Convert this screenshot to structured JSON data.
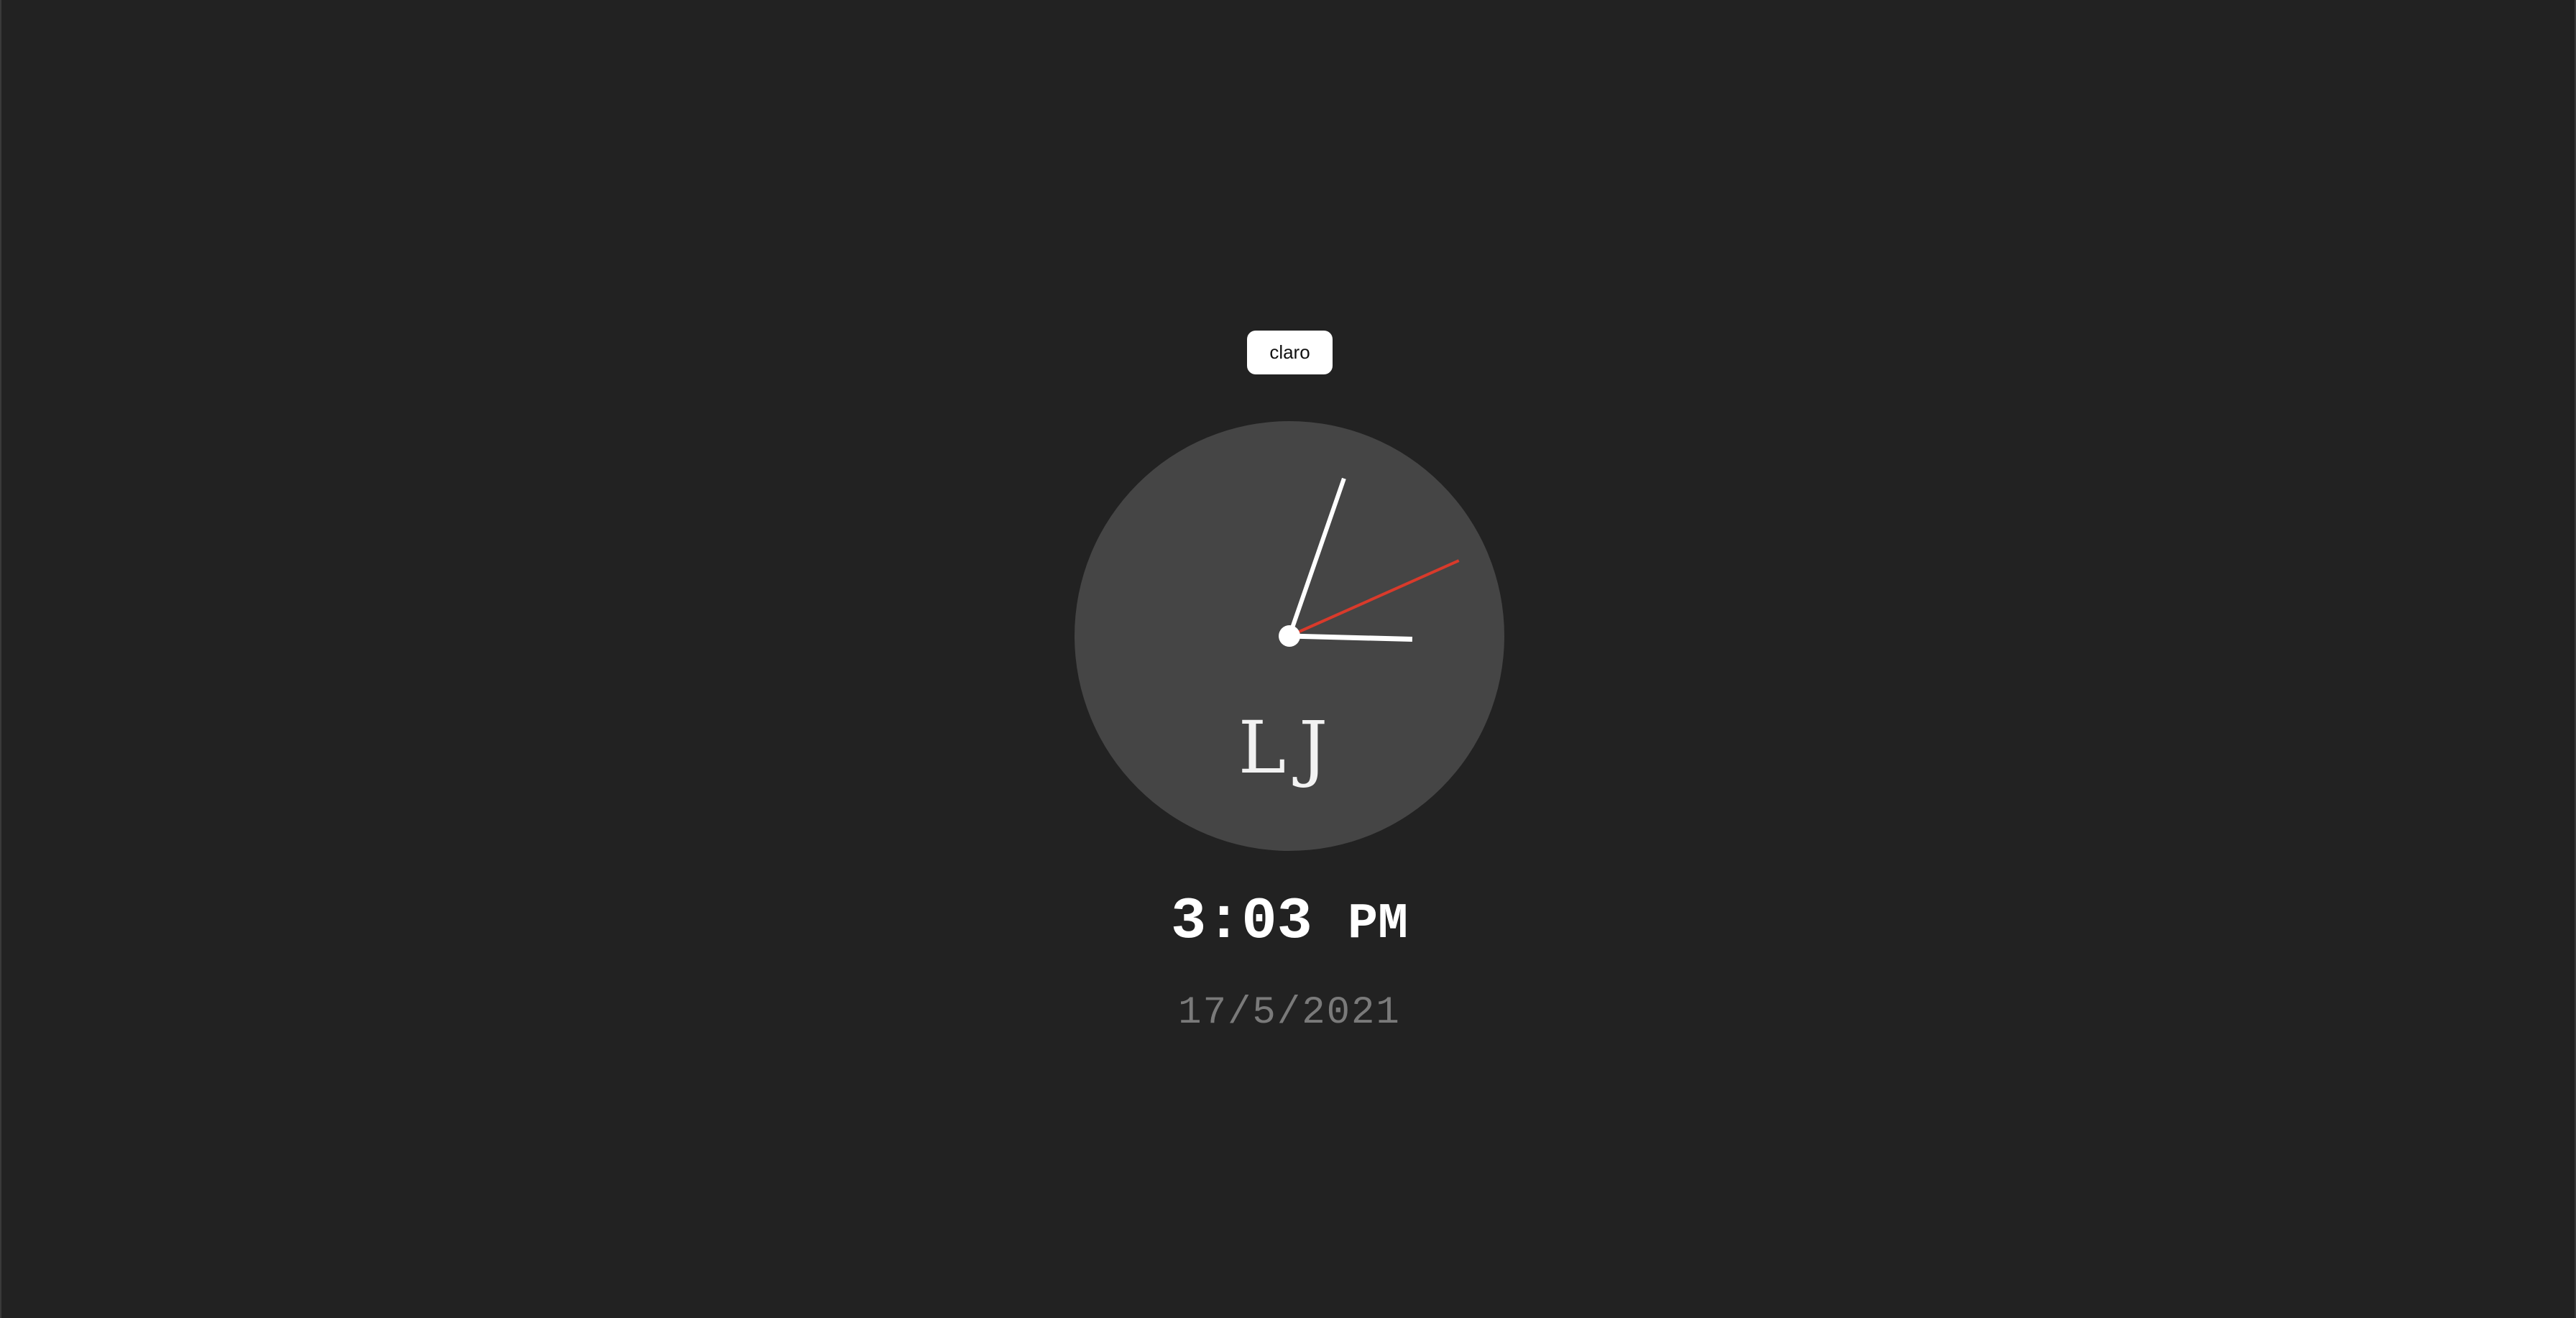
{
  "theme_toggle": {
    "label": "claro"
  },
  "clock": {
    "hour": 3,
    "minute": 3,
    "second": 11,
    "monogram": "LJ",
    "colors": {
      "face": "#454545",
      "hands": "#ffffff",
      "second_hand": "#d93a2b",
      "hub": "#ffffff"
    }
  },
  "digital": {
    "time": "3:03",
    "period": "PM"
  },
  "date": {
    "text": "17/5/2021"
  },
  "colors": {
    "background": "#222222",
    "date_text": "#7a7a7a"
  }
}
